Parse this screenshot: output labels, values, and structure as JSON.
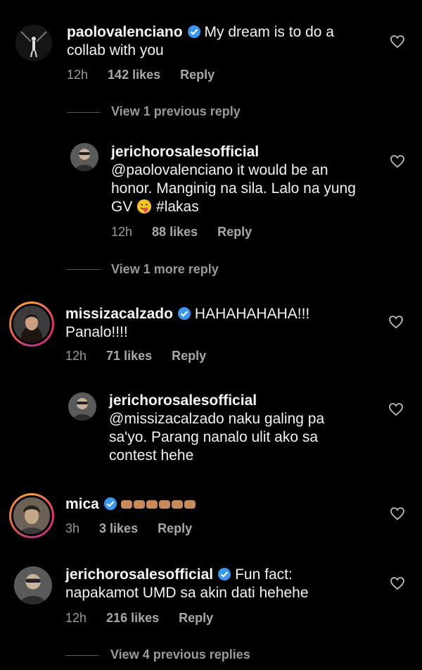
{
  "comments": [
    {
      "username": "paolovalenciano",
      "line1": "My dream is to do a",
      "line2": "collab with you",
      "time": "12h",
      "likes": "142 likes",
      "reply": "Reply"
    },
    {
      "username": "jerichorosalesofficial",
      "line1": "@paolovalenciano it would be an",
      "line2": "honor. Manginig na sila. Lalo na yung",
      "line3_pre": "GV",
      "line3_post": "#lakas",
      "time": "12h",
      "likes": "88 likes",
      "reply": "Reply"
    },
    {
      "username": "missizacalzado",
      "line1": "HAHAHAHAHA!!!",
      "line2": "Panalo!!!!",
      "time": "12h",
      "likes": "71 likes",
      "reply": "Reply"
    },
    {
      "username": "jerichorosalesofficial",
      "line1": "@missizacalzado naku galing pa",
      "line2": "sa'yo. Parang nanalo ulit ako sa",
      "line3": "contest hehe"
    },
    {
      "username": "mica",
      "time": "3h",
      "likes": "3 likes",
      "reply": "Reply"
    },
    {
      "username": "jerichorosalesofficial",
      "line1": "Fun fact:",
      "line2": "napakamot UMD sa akin dati hehehe",
      "time": "12h",
      "likes": "216 likes",
      "reply": "Reply"
    }
  ],
  "view_replies": {
    "previous_reply": "View 1 previous reply",
    "more_reply": "View 1 more reply",
    "previous_replies": "View 4 previous replies"
  },
  "colors": {
    "background": "#000000",
    "verified": "#3897f0",
    "meta": "#9a9a9a"
  }
}
